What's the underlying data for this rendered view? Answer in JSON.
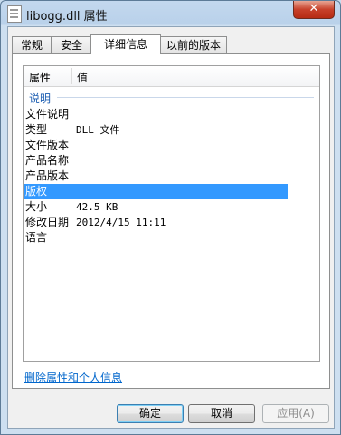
{
  "window": {
    "title": "libogg.dll 属性",
    "close_label": "✕"
  },
  "tabs": [
    {
      "label": "常规"
    },
    {
      "label": "安全"
    },
    {
      "label": "详细信息"
    },
    {
      "label": "以前的版本"
    }
  ],
  "active_tab": "详细信息",
  "details": {
    "columns": {
      "property": "属性",
      "value": "值"
    },
    "group_label": "说明",
    "rows": [
      {
        "name": "文件说明",
        "value": ""
      },
      {
        "name": "类型",
        "value": "DLL 文件"
      },
      {
        "name": "文件版本",
        "value": ""
      },
      {
        "name": "产品名称",
        "value": ""
      },
      {
        "name": "产品版本",
        "value": ""
      },
      {
        "name": "版权",
        "value": ""
      },
      {
        "name": "大小",
        "value": "42.5 KB"
      },
      {
        "name": "修改日期",
        "value": "2012/4/15 11:11"
      },
      {
        "name": "语言",
        "value": ""
      }
    ],
    "selected_row": "版权"
  },
  "remove_link": "删除属性和个人信息",
  "buttons": {
    "ok": "确定",
    "cancel": "取消",
    "apply": "应用(A)"
  }
}
